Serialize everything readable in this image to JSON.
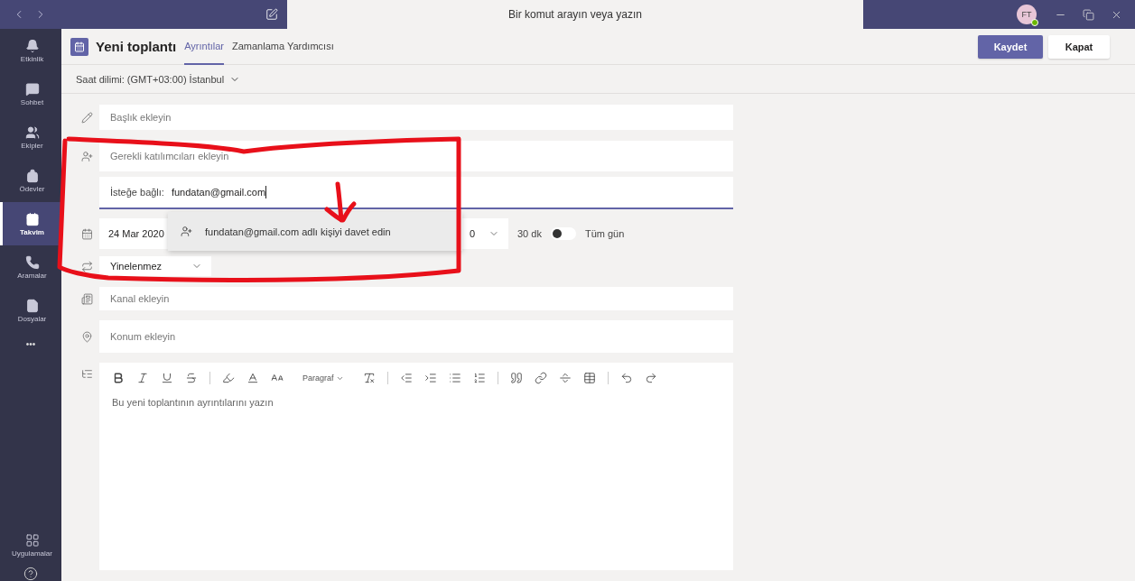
{
  "title_bar": {
    "search": {
      "placeholder": "Bir komut arayın veya yazın"
    },
    "avatar": {
      "initials": "FT",
      "online": true
    }
  },
  "sidebar": {
    "items": [
      {
        "label": "Etkinlik",
        "kind": "bell",
        "selected": false
      },
      {
        "label": "Sohbet",
        "kind": "chat",
        "selected": false
      },
      {
        "label": "Ekipler",
        "kind": "teams",
        "selected": false
      },
      {
        "label": "Ödevler",
        "kind": "bag",
        "selected": false
      },
      {
        "label": "Takvim",
        "kind": "calendar",
        "selected": true
      },
      {
        "label": "Aramalar",
        "kind": "phone",
        "selected": false
      },
      {
        "label": "Dosyalar",
        "kind": "file",
        "selected": false
      }
    ],
    "more": "•••",
    "bottom": {
      "label": "Uygulamalar"
    }
  },
  "header": {
    "title": "Yeni toplantı",
    "tabs": [
      {
        "label": "Ayrıntılar",
        "selected": true
      },
      {
        "label": "Zamanlama Yardımcısı",
        "selected": false
      }
    ],
    "buttons": [
      {
        "label": "Kaydet",
        "kind": "primary"
      },
      {
        "label": "Kapat",
        "kind": "secondary"
      }
    ]
  },
  "timezone": {
    "label": "Saat dilimi: (GMT+03:00) İstanbul"
  },
  "form": {
    "title": {
      "placeholder": "Başlık ekleyin"
    },
    "required": {
      "placeholder": "Gerekli katılımcıları ekleyin"
    },
    "optional": {
      "label": "İsteğe bağlı:",
      "value": "fundatan@gmail.com"
    },
    "date": {
      "value": "24 Mar 2020"
    },
    "end_time": {
      "value": "0"
    },
    "duration": "30 dk",
    "all_day": {
      "label": "Tüm gün",
      "on": false
    },
    "recurrence": {
      "value": "Yinelenmez"
    },
    "channel": {
      "placeholder": "Kanal ekleyin"
    },
    "location": {
      "placeholder": "Konum ekleyin"
    },
    "editor": {
      "format": "Paragraf",
      "placeholder": "Bu yeni toplantının ayrıntılarını yazın"
    }
  },
  "suggestion": {
    "text": "fundatan@gmail.com adlı kişiyi davet edin"
  }
}
